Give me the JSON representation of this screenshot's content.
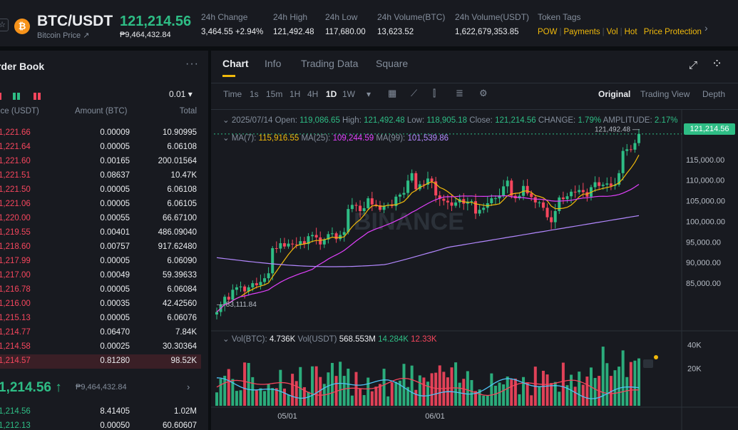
{
  "header": {
    "star": "☆",
    "coin_glyph": "₿",
    "pair": "BTC/USDT",
    "subtitle": "Bitcoin Price ↗",
    "last_price": "121,214.56",
    "last_fiat": "₱9,464,432.84",
    "stats": [
      {
        "label": "24h Change",
        "value": "3,464.55 +2.94%",
        "color": "#2ebd85"
      },
      {
        "label": "24h High",
        "value": "121,492.48",
        "color": "#eaecef"
      },
      {
        "label": "24h Low",
        "value": "117,680.00",
        "color": "#eaecef"
      },
      {
        "label": "24h Volume(BTC)",
        "value": "13,623.52",
        "color": "#eaecef"
      },
      {
        "label": "24h Volume(USDT)",
        "value": "1,622,679,353.85",
        "color": "#eaecef"
      }
    ],
    "tags_label": "Token Tags",
    "tags": [
      "POW",
      "Payments",
      "Vol",
      "Hot",
      "Price Protection"
    ],
    "more": "›"
  },
  "orderbook": {
    "title": "rder Book",
    "more": "···",
    "step": "0.01 ▾",
    "col_price": "ice (USDT)",
    "col_amount": "Amount (BTC)",
    "col_total": "Total",
    "asks": [
      {
        "p": "1,221.66",
        "a": "0.00009",
        "t": "10.90995"
      },
      {
        "p": "1,221.64",
        "a": "0.00005",
        "t": "6.06108"
      },
      {
        "p": "1,221.60",
        "a": "0.00165",
        "t": "200.01564"
      },
      {
        "p": "1,221.51",
        "a": "0.08637",
        "t": "10.47K"
      },
      {
        "p": "1,221.50",
        "a": "0.00005",
        "t": "6.06108"
      },
      {
        "p": "1,221.06",
        "a": "0.00005",
        "t": "6.06105"
      },
      {
        "p": "1,220.00",
        "a": "0.00055",
        "t": "66.67100"
      },
      {
        "p": "1,219.55",
        "a": "0.00401",
        "t": "486.09040"
      },
      {
        "p": "1,218.60",
        "a": "0.00757",
        "t": "917.62480"
      },
      {
        "p": "1,217.99",
        "a": "0.00005",
        "t": "6.06090"
      },
      {
        "p": "1,217.00",
        "a": "0.00049",
        "t": "59.39633"
      },
      {
        "p": "1,216.78",
        "a": "0.00005",
        "t": "6.06084"
      },
      {
        "p": "1,216.00",
        "a": "0.00035",
        "t": "42.42560"
      },
      {
        "p": "1,215.13",
        "a": "0.00005",
        "t": "6.06076"
      },
      {
        "p": "1,214.77",
        "a": "0.06470",
        "t": "7.84K"
      },
      {
        "p": "1,214.58",
        "a": "0.00025",
        "t": "30.30364"
      },
      {
        "p": "1,214.57",
        "a": "0.81280",
        "t": "98.52K"
      }
    ],
    "mid_price": "1,214.56 ↑",
    "mid_fiat": "₱9,464,432.84",
    "mid_chev": "›",
    "bids": [
      {
        "p": "1,214.56",
        "a": "8.41405",
        "t": "1.02M"
      },
      {
        "p": "1,212.13",
        "a": "0.00050",
        "t": "60.60607"
      }
    ]
  },
  "chart_panel": {
    "tabs": [
      "Chart",
      "Info",
      "Trading Data",
      "Square"
    ],
    "expand_icon": "⤢",
    "grid_icon": "⁘",
    "intervals": [
      "Time",
      "1s",
      "15m",
      "1H",
      "4H",
      "1D",
      "1W"
    ],
    "active_interval": "1D",
    "dropdown": "▾",
    "views": [
      "Original",
      "Trading View",
      "Depth"
    ],
    "info": {
      "date": "2025/07/14",
      "open_label": "Open:",
      "open": "119,086.65",
      "high_label": "High:",
      "high": "121,492.48",
      "low_label": "Low:",
      "low": "118,905.18",
      "close_label": "Close:",
      "close": "121,214.56",
      "change_label": "CHANGE:",
      "change": "1.79%",
      "amp_label": "AMPLITUDE:",
      "amp": "2.17%"
    },
    "ma": {
      "ma7_label": "MA(7):",
      "ma7": "115,916.55",
      "ma25_label": "MA(25):",
      "ma25": "109,244.59",
      "ma99_label": "MA(99):",
      "ma99": "101,539.86"
    },
    "vol": {
      "btc_label": "Vol(BTC):",
      "btc": "4.736K",
      "usdt_label": "Vol(USDT)",
      "usdt": "568.553M",
      "v1": "14.284K",
      "v2": "12.33K"
    },
    "watermark": "BINANCE",
    "high_mark": "121,492.48",
    "low_mark": "83,111.84",
    "current_price": "121,214.56",
    "y_labels": [
      "115,000.00",
      "110,000.00",
      "105,000.00",
      "100,000.00",
      "95,000.00",
      "90,000.00",
      "85,000.00"
    ],
    "vol_labels": [
      "40K",
      "20K"
    ],
    "x_labels": [
      "05/01",
      "06/01"
    ],
    "colors": {
      "up": "#2ebd85",
      "down": "#f6465d",
      "accent": "#f0b90b",
      "ma25": "#e040fb",
      "ma99": "#b388ff"
    }
  },
  "chart_data": {
    "type": "candlestick",
    "x_range": [
      "04/08",
      "07/14"
    ],
    "ylim": [
      80000,
      125000
    ],
    "close": [
      78000,
      79800,
      81700,
      81000,
      83400,
      84000,
      84200,
      83000,
      84000,
      85000,
      84500,
      85300,
      86200,
      87400,
      93500,
      93400,
      94700,
      93900,
      94600,
      94400,
      94300,
      95200,
      94500,
      96400,
      96700,
      96100,
      94400,
      95600,
      96900,
      97100,
      95700,
      96700,
      97400,
      103000,
      104000,
      103800,
      102500,
      103200,
      105600,
      104100,
      103900,
      102800,
      103800,
      104000,
      103700,
      106000,
      106500,
      106900,
      109900,
      111700,
      107800,
      109000,
      108900,
      110400,
      109700,
      106300,
      105500,
      105000,
      104600,
      103800,
      104600,
      105400,
      104300,
      104800,
      104900,
      101900,
      102800,
      103300,
      104400,
      105600,
      105600,
      106300,
      108500,
      109900,
      106200,
      105600,
      106200,
      108600,
      106800,
      105900,
      104600,
      104600,
      103300,
      101000,
      99800,
      102500,
      105800,
      105400,
      106100,
      107200,
      107100,
      107600,
      107100,
      106000,
      108300,
      109500,
      108600,
      108900,
      109200,
      108600,
      108900,
      111700,
      117100,
      117500,
      117400,
      119000,
      121214
    ]
  }
}
